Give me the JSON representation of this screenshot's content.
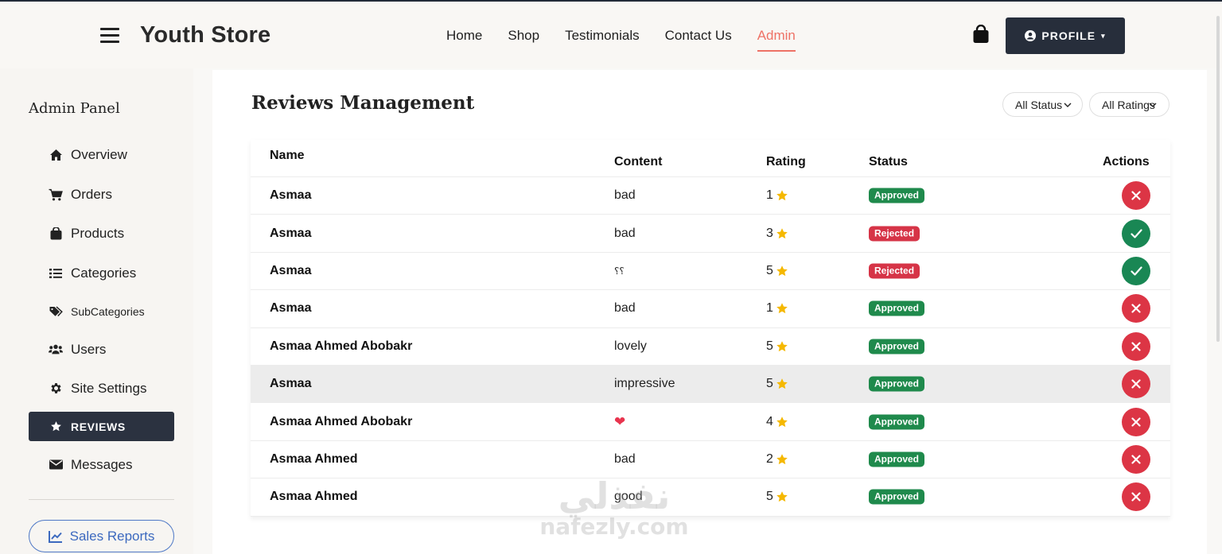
{
  "header": {
    "brand": "Youth Store",
    "nav": [
      {
        "label": "Home",
        "active": false
      },
      {
        "label": "Shop",
        "active": false
      },
      {
        "label": "Testimonials",
        "active": false
      },
      {
        "label": "Contact Us",
        "active": false
      },
      {
        "label": "Admin",
        "active": true
      }
    ],
    "profile_label": "PROFILE",
    "icons": {
      "menu": "hamburger-icon",
      "bag": "shopping-bag-icon",
      "user": "user-circle-icon"
    }
  },
  "sidebar": {
    "title": "Admin Panel",
    "items": [
      {
        "label": "Overview",
        "icon": "home-icon",
        "active": false
      },
      {
        "label": "Orders",
        "icon": "cart-icon",
        "active": false
      },
      {
        "label": "Products",
        "icon": "box-icon",
        "active": false
      },
      {
        "label": "Categories",
        "icon": "list-icon",
        "active": false
      },
      {
        "label": "SubCategories",
        "icon": "tags-icon",
        "active": false
      },
      {
        "label": "Users",
        "icon": "users-icon",
        "active": false
      },
      {
        "label": "Site Settings",
        "icon": "gear-icon",
        "active": false
      },
      {
        "label": "REVIEWS",
        "icon": "star-icon",
        "active": true
      },
      {
        "label": "Messages",
        "icon": "envelope-icon",
        "active": false
      }
    ],
    "sales_reports": "Sales Reports"
  },
  "main": {
    "title": "Reviews Management",
    "filters": {
      "status": "All Status",
      "ratings": "All Ratings"
    },
    "columns": {
      "name": "Name",
      "content": "Content",
      "rating": "Rating",
      "status": "Status",
      "actions": "Actions"
    },
    "rows": [
      {
        "name": "Asmaa",
        "content": "bad",
        "rating": "1",
        "status": "Approved",
        "action": "reject"
      },
      {
        "name": "Asmaa",
        "content": "bad",
        "rating": "3",
        "status": "Rejected",
        "action": "approve"
      },
      {
        "name": "Asmaa",
        "content": "؟؟",
        "rating": "5",
        "status": "Rejected",
        "action": "approve"
      },
      {
        "name": "Asmaa",
        "content": "bad",
        "rating": "1",
        "status": "Approved",
        "action": "reject"
      },
      {
        "name": "Asmaa Ahmed Abobakr",
        "content": "lovely",
        "rating": "5",
        "status": "Approved",
        "action": "reject"
      },
      {
        "name": "Asmaa",
        "content": "impressive",
        "rating": "5",
        "status": "Approved",
        "action": "reject",
        "highlight": true
      },
      {
        "name": "Asmaa Ahmed Abobakr",
        "content": "❤",
        "rating": "4",
        "status": "Approved",
        "action": "reject"
      },
      {
        "name": "Asmaa Ahmed",
        "content": "bad",
        "rating": "2",
        "status": "Approved",
        "action": "reject"
      },
      {
        "name": "Asmaa Ahmed",
        "content": "good",
        "rating": "5",
        "status": "Approved",
        "action": "reject"
      }
    ]
  },
  "colors": {
    "approved": "#1f8a4c",
    "rejected": "#d63447",
    "reject_button": "#dc3545",
    "approve_button": "#198754",
    "star": "#f5b800",
    "accent": "#ee7266",
    "dark": "#2b3240"
  },
  "watermark": {
    "arabic": "نفذلي",
    "latin": "nafezly.com"
  }
}
